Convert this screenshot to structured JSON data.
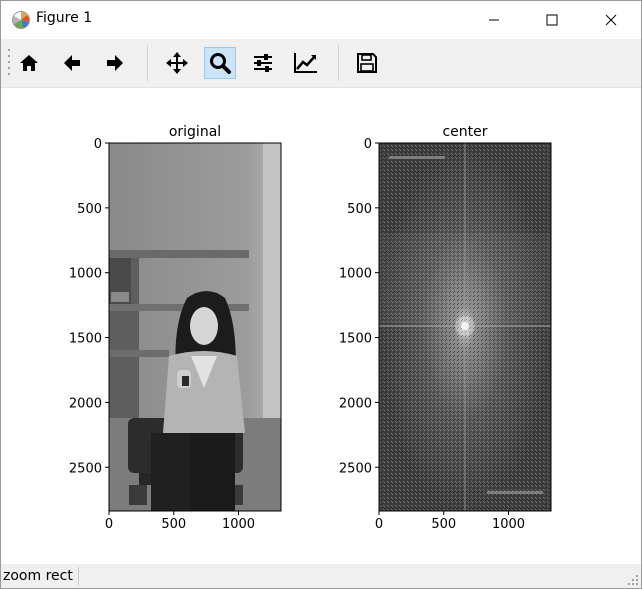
{
  "window": {
    "title": "Figure 1",
    "minimize_icon": "minimize-icon",
    "maximize_icon": "maximize-icon",
    "close_icon": "close-icon"
  },
  "toolbar": {
    "buttons": [
      {
        "name": "home",
        "icon": "home-icon"
      },
      {
        "name": "back",
        "icon": "arrow-left-icon"
      },
      {
        "name": "forward",
        "icon": "arrow-right-icon"
      },
      {
        "name": "pan",
        "icon": "move-icon"
      },
      {
        "name": "zoom",
        "icon": "magnifier-icon",
        "active": true
      },
      {
        "name": "subplots",
        "icon": "sliders-icon"
      },
      {
        "name": "customize",
        "icon": "line-chart-icon"
      },
      {
        "name": "save",
        "icon": "floppy-disk-icon"
      }
    ],
    "active_color": "#cce4f7"
  },
  "figure": {
    "subplots": [
      {
        "title": "original",
        "xticks": [
          "0",
          "500",
          "1000"
        ],
        "yticks": [
          "0",
          "500",
          "1000",
          "1500",
          "2000",
          "2500"
        ]
      },
      {
        "title": "center",
        "xticks": [
          "0",
          "500",
          "1000"
        ],
        "yticks": [
          "0",
          "500",
          "1000",
          "1500",
          "2000",
          "2500"
        ]
      }
    ]
  },
  "status": {
    "text": "zoom rect"
  }
}
